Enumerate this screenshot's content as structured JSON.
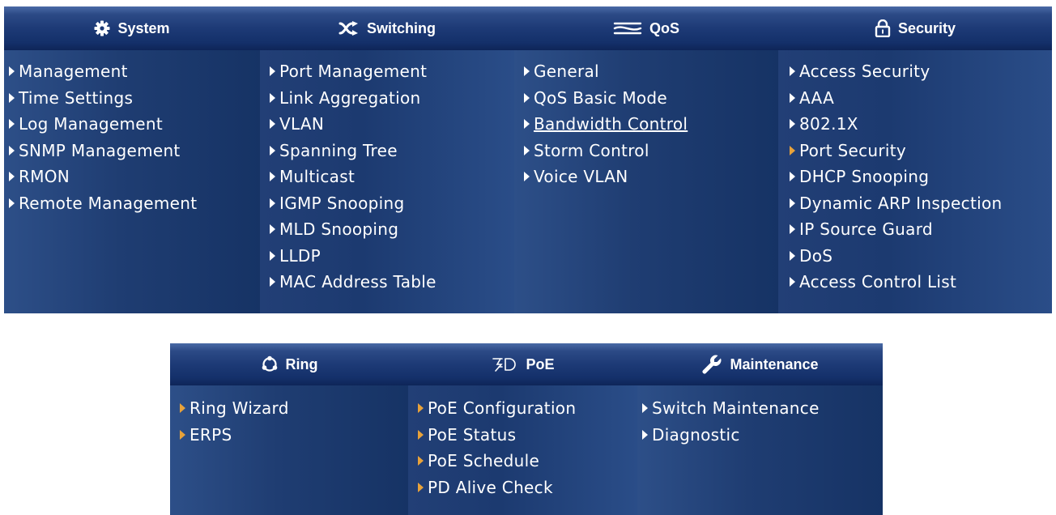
{
  "top_menu": {
    "system": {
      "title": "System",
      "icon": "gear-icon",
      "items": [
        "Management",
        "Time Settings",
        "Log Management",
        "SNMP Management",
        "RMON",
        "Remote Management"
      ]
    },
    "switching": {
      "title": "Switching",
      "icon": "switching-arrows-icon",
      "items": [
        "Port Management",
        "Link Aggregation",
        "VLAN",
        "Spanning Tree",
        "Multicast",
        "IGMP Snooping",
        "MLD Snooping",
        "LLDP",
        "MAC Address Table"
      ]
    },
    "qos": {
      "title": "QoS",
      "icon": "qos-lines-icon",
      "items": [
        "General",
        "QoS Basic Mode",
        "Bandwidth Control",
        "Storm Control",
        "Voice VLAN"
      ]
    },
    "security": {
      "title": "Security",
      "icon": "padlock-icon",
      "items": [
        "Access Security",
        "AAA",
        "802.1X",
        "Port Security",
        "DHCP Snooping",
        "Dynamic ARP Inspection",
        "IP Source Guard",
        "DoS",
        "Access Control List"
      ]
    }
  },
  "bottom_menu": {
    "ring": {
      "title": "Ring",
      "icon": "ring-icon",
      "items": [
        "Ring Wizard",
        "ERPS"
      ]
    },
    "poe": {
      "title": "PoE",
      "icon": "poe-plug-icon",
      "items": [
        "PoE Configuration",
        "PoE Status",
        "PoE Schedule",
        "PD Alive Check"
      ]
    },
    "maintenance": {
      "title": "Maintenance",
      "icon": "wrench-icon",
      "items": [
        "Switch Maintenance",
        "Diagnostic"
      ]
    }
  },
  "colors": {
    "arrow_default": "#ffffff",
    "arrow_highlight": "#e8a23a",
    "text": "#ffffff"
  }
}
